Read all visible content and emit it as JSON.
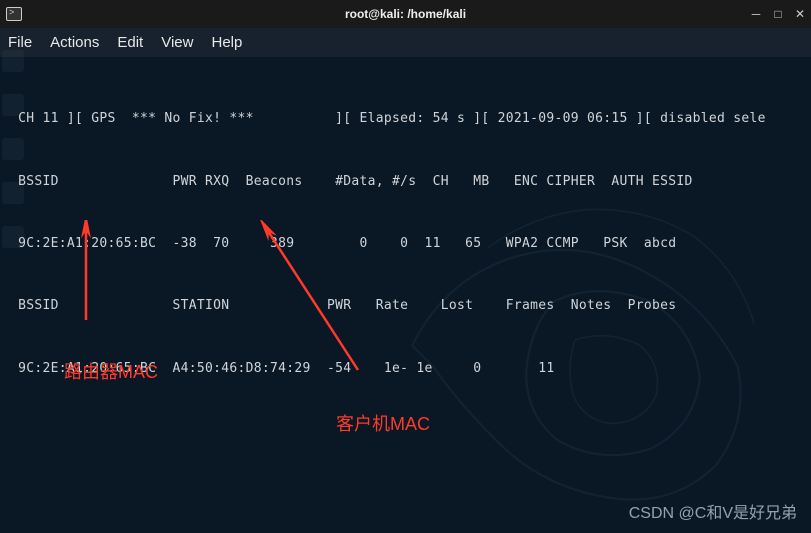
{
  "window": {
    "title": "root@kali: /home/kali"
  },
  "menu": {
    "file": "File",
    "actions": "Actions",
    "edit": "Edit",
    "view": "View",
    "help": "Help"
  },
  "terminal": {
    "line1": " CH 11 ][ GPS  *** No Fix! ***          ][ Elapsed: 54 s ][ 2021-09-09 06:15 ][ disabled sele",
    "header1": " BSSID              PWR RXQ  Beacons    #Data, #/s  CH   MB   ENC CIPHER  AUTH ESSID",
    "row1": " 9C:2E:A1:20:65:BC  -38  70     389        0    0  11   65   WPA2 CCMP   PSK  abcd",
    "header2": " BSSID              STATION            PWR   Rate    Lost    Frames  Notes  Probes",
    "row2": " 9C:2E:A1:20:65:BC  A4:50:46:D8:74:29  -54    1e- 1e     0       11"
  },
  "annotations": {
    "router_mac": "路由器MAC",
    "client_mac": "客户机MAC"
  },
  "watermark": "CSDN @C和V是好兄弟"
}
